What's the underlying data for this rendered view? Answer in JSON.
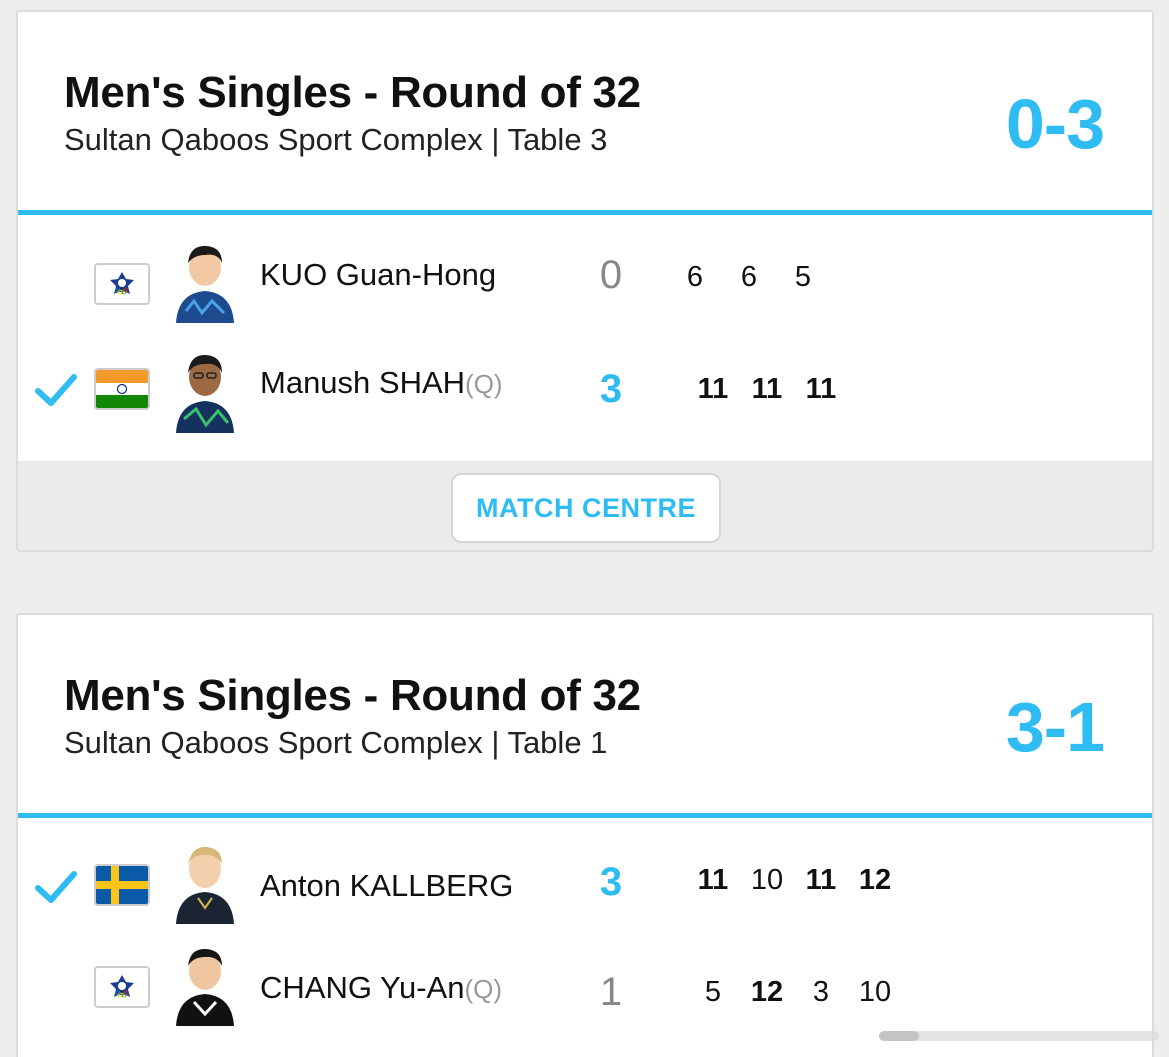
{
  "colors": {
    "accent": "#2ebcf2",
    "card_bg": "#ffffff",
    "footer_bg": "#ebebeb",
    "page_bg": "#eeeeee"
  },
  "matches": [
    {
      "title": "Men's Singles - Round of 32",
      "venue": "Sultan Qaboos Sport Complex | Table 3",
      "score": "0-3",
      "players": [
        {
          "name": "KUO Guan-Hong",
          "qualifier": "",
          "flag": "chinese-taipei-flag",
          "sets": "0",
          "winner": false,
          "games": [
            "6",
            "6",
            "5"
          ]
        },
        {
          "name": "Manush SHAH",
          "qualifier": "(Q)",
          "flag": "india-flag",
          "sets": "3",
          "winner": true,
          "games": [
            "11",
            "11",
            "11"
          ]
        }
      ],
      "button": "MATCH CENTRE"
    },
    {
      "title": "Men's Singles - Round of 32",
      "venue": "Sultan Qaboos Sport Complex | Table 1",
      "score": "3-1",
      "players": [
        {
          "name": "Anton KALLBERG",
          "qualifier": "",
          "flag": "sweden-flag",
          "sets": "3",
          "winner": true,
          "games": [
            "11",
            "10",
            "11",
            "12"
          ]
        },
        {
          "name": "CHANG Yu-An",
          "qualifier": "(Q)",
          "flag": "chinese-taipei-flag",
          "sets": "1",
          "winner": false,
          "games": [
            "5",
            "12",
            "3",
            "10"
          ]
        }
      ]
    }
  ]
}
